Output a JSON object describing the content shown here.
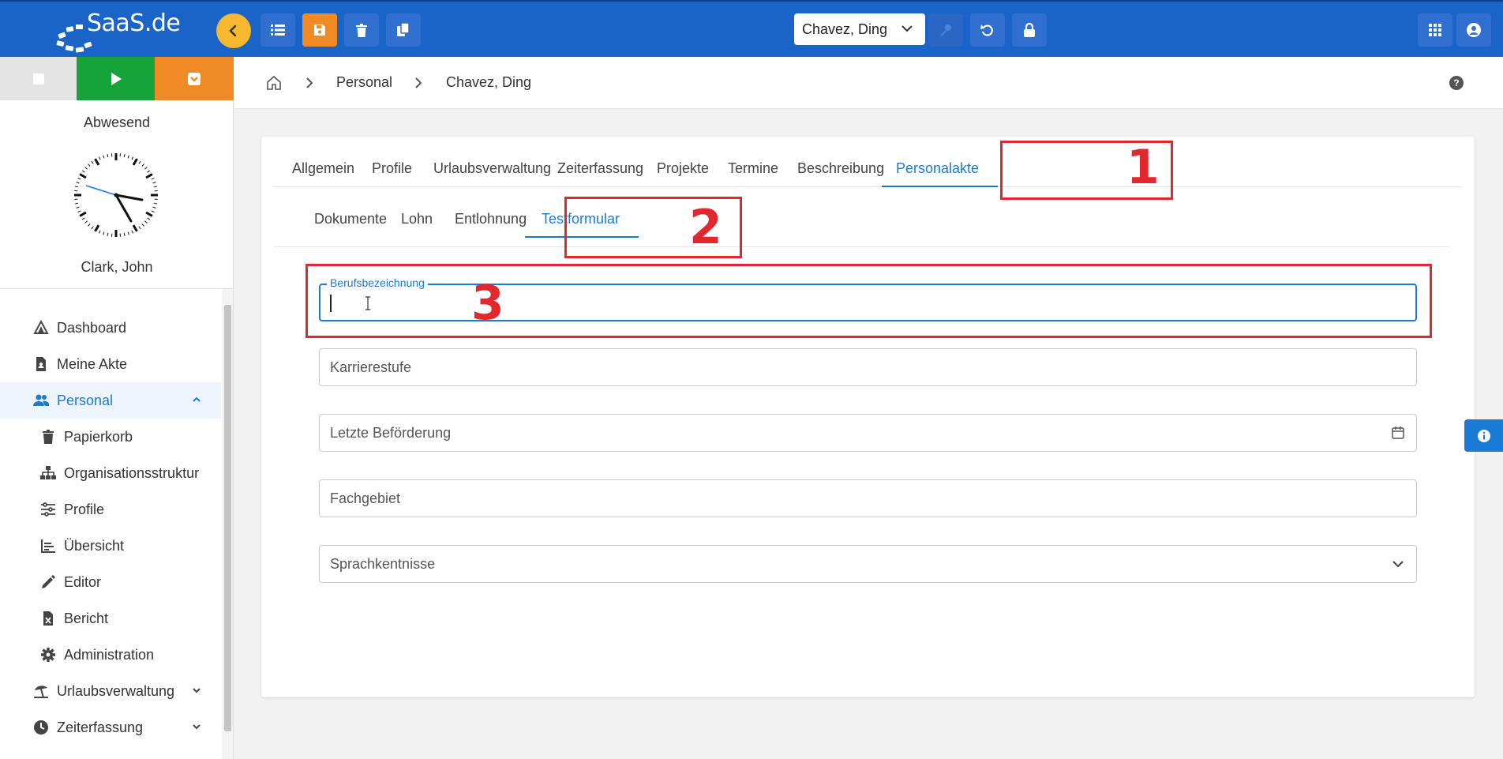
{
  "app": {
    "logo_text": "SaaS.de"
  },
  "topbar": {
    "employee_select": "Chavez, Ding",
    "icons": [
      "back-icon",
      "list-icon",
      "save-icon",
      "trash-icon",
      "copy-icon",
      "key-icon",
      "undo-icon",
      "lock-icon",
      "apps-grid-icon",
      "account-icon"
    ]
  },
  "sidebar": {
    "status_label": "Abwesend",
    "user_name": "Clark, John",
    "nav": [
      {
        "label": "Dashboard",
        "icon": "dashboard-icon"
      },
      {
        "label": "Meine Akte",
        "icon": "file-icon"
      },
      {
        "label": "Personal",
        "icon": "people-icon",
        "active": true
      },
      {
        "label": "Papierkorb",
        "icon": "trash-icon"
      },
      {
        "label": "Organisationsstruktur",
        "icon": "sitemap-icon"
      },
      {
        "label": "Profile",
        "icon": "sliders-icon"
      },
      {
        "label": "Übersicht",
        "icon": "chart-icon"
      },
      {
        "label": "Editor",
        "icon": "pencil-icon"
      },
      {
        "label": "Bericht",
        "icon": "excel-file-icon"
      },
      {
        "label": "Administration",
        "icon": "gear-icon"
      },
      {
        "label": "Urlaubsverwaltung",
        "icon": "beach-umbrella-icon"
      },
      {
        "label": "Zeiterfassung",
        "icon": "clock-icon"
      }
    ]
  },
  "breadcrumb": {
    "items": [
      "Personal",
      "Chavez, Ding"
    ]
  },
  "tabs": {
    "main": [
      "Allgemein",
      "Profile",
      "Urlaubsverwaltung",
      "Zeiterfassung",
      "Projekte",
      "Termine",
      "Beschreibung",
      "Personalakte"
    ],
    "main_active": "Personalakte",
    "sub": [
      "Dokumente",
      "Lohn",
      "Entlohnung",
      "Testformular"
    ],
    "sub_active": "Testformular"
  },
  "form": {
    "berufsbezeichnung_label": "Berufsbezeichnung",
    "berufsbezeichnung_value": "",
    "karrierestufe_placeholder": "Karrierestufe",
    "letzte_befoerderung_placeholder": "Letzte Beförderung",
    "fachgebiet_placeholder": "Fachgebiet",
    "sprachkenntnisse_placeholder": "Sprachkentnisse"
  },
  "annotations": [
    "1",
    "2",
    "3"
  ],
  "colors": {
    "topbar": "#1a63c7",
    "accent": "#1a7bd6",
    "orange": "#f08a24",
    "green": "#16a33a",
    "annotation_red": "#e0282e"
  }
}
